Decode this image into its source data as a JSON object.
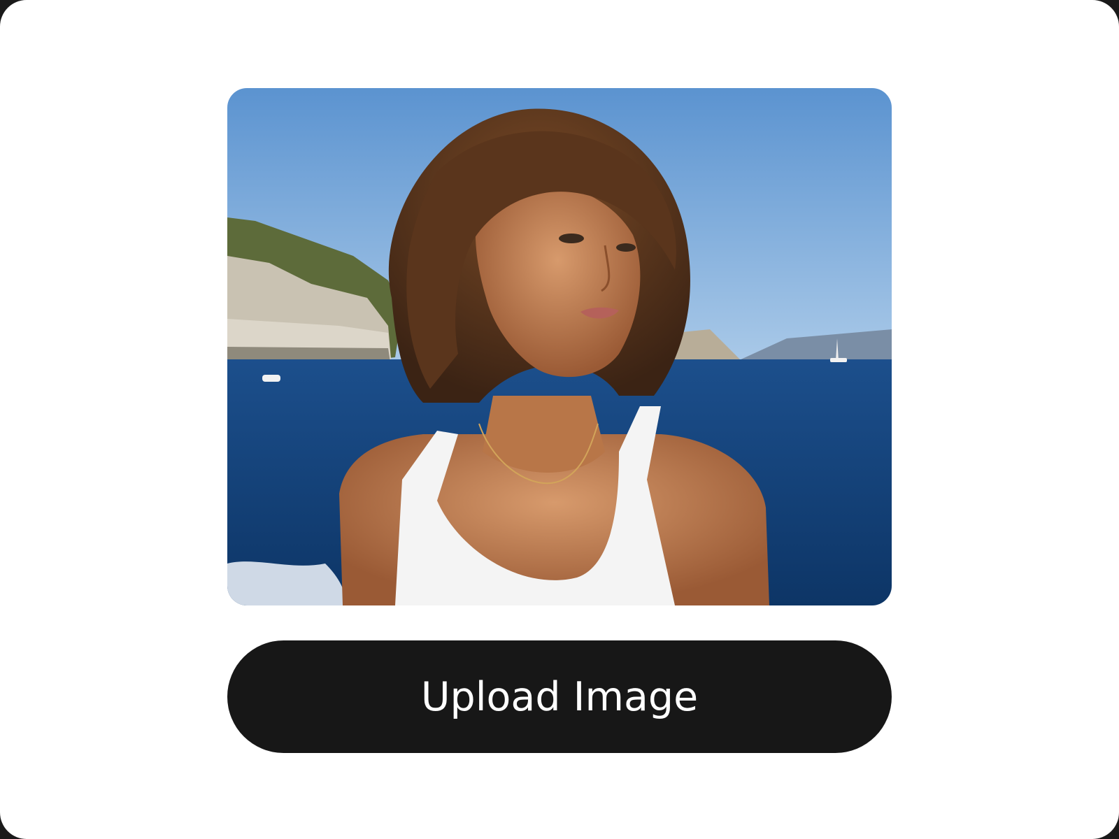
{
  "upload": {
    "button_label": "Upload Image"
  },
  "photo": {
    "icon": "photo-preview"
  },
  "colors": {
    "button_background": "#171717",
    "button_text": "#ffffff",
    "card_background": "#ffffff"
  }
}
